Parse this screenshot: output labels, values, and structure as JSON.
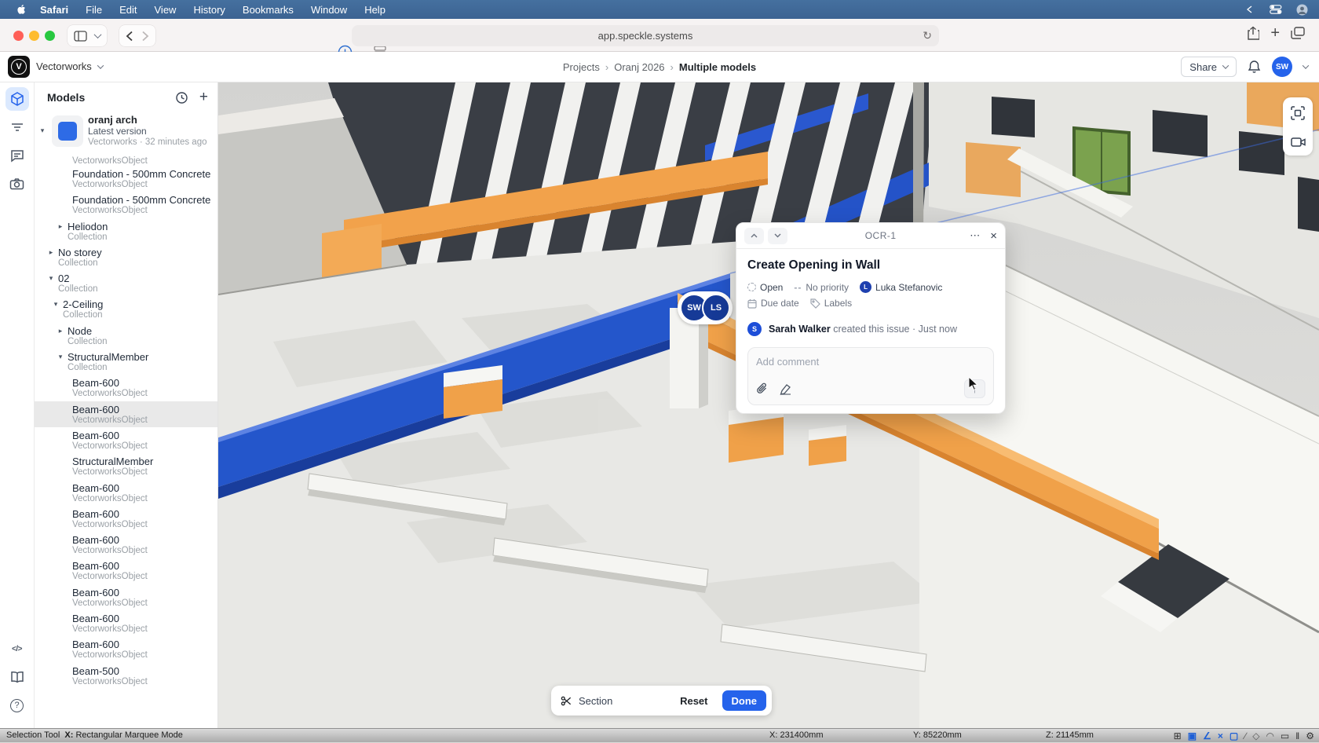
{
  "palette": {
    "accent": "#2563eb",
    "beam_orange": "#f0a149",
    "beam_blue": "#2456cb"
  },
  "menubar": {
    "items": [
      {
        "label": "Safari",
        "cls": "bold"
      },
      {
        "label": "File",
        "cls": ""
      },
      {
        "label": "Edit",
        "cls": ""
      },
      {
        "label": "View",
        "cls": ""
      },
      {
        "label": "History",
        "cls": ""
      },
      {
        "label": "Bookmarks",
        "cls": ""
      },
      {
        "label": "Window",
        "cls": ""
      },
      {
        "label": "Help",
        "cls": ""
      }
    ]
  },
  "browser": {
    "url": "app.speckle.systems",
    "reload_glyph": "↻",
    "new_tab_glyph": "+"
  },
  "app_header": {
    "workspace": "Vectorworks",
    "breadcrumbs": [
      "Projects",
      "Oranj 2026",
      "Multiple models"
    ],
    "share_label": "Share",
    "avatar_initials": "SW"
  },
  "models_panel": {
    "title": "Models",
    "model": {
      "name": "oranj arch",
      "version": "Latest version",
      "meta": "Vectorworks · 32 minutes ago",
      "caret": "▾"
    },
    "tree": [
      {
        "name": "",
        "type": "VectorworksObject",
        "dc": "d4",
        "arrow": "",
        "state": "clipped"
      },
      {
        "name": "Foundation - 500mm Concrete",
        "type": "VectorworksObject",
        "dc": "d4",
        "arrow": "",
        "state": ""
      },
      {
        "name": "Foundation - 500mm Concrete",
        "type": "VectorworksObject",
        "dc": "d4",
        "arrow": "",
        "state": ""
      },
      {
        "name": "Heliodon",
        "type": "Collection",
        "dc": "d3",
        "arrow": "▸",
        "state": ""
      },
      {
        "name": "No storey",
        "type": "Collection",
        "dc": "d1",
        "arrow": "▸",
        "state": ""
      },
      {
        "name": "02",
        "type": "Collection",
        "dc": "d1",
        "arrow": "▾",
        "state": ""
      },
      {
        "name": "2-Ceiling",
        "type": "Collection",
        "dc": "d2",
        "arrow": "▾",
        "state": ""
      },
      {
        "name": "Node",
        "type": "Collection",
        "dc": "d3",
        "arrow": "▸",
        "state": ""
      },
      {
        "name": "StructuralMember",
        "type": "Collection",
        "dc": "d3",
        "arrow": "▾",
        "state": ""
      },
      {
        "name": "Beam-600",
        "type": "VectorworksObject",
        "dc": "d4",
        "arrow": "",
        "state": ""
      },
      {
        "name": "Beam-600",
        "type": "VectorworksObject",
        "dc": "d4",
        "arrow": "",
        "state": "selected"
      },
      {
        "name": "Beam-600",
        "type": "VectorworksObject",
        "dc": "d4",
        "arrow": "",
        "state": ""
      },
      {
        "name": "StructuralMember",
        "type": "VectorworksObject",
        "dc": "d4",
        "arrow": "",
        "state": ""
      },
      {
        "name": "Beam-600",
        "type": "VectorworksObject",
        "dc": "d4",
        "arrow": "",
        "state": ""
      },
      {
        "name": "Beam-600",
        "type": "VectorworksObject",
        "dc": "d4",
        "arrow": "",
        "state": ""
      },
      {
        "name": "Beam-600",
        "type": "VectorworksObject",
        "dc": "d4",
        "arrow": "",
        "state": ""
      },
      {
        "name": "Beam-600",
        "type": "VectorworksObject",
        "dc": "d4",
        "arrow": "",
        "state": ""
      },
      {
        "name": "Beam-600",
        "type": "VectorworksObject",
        "dc": "d4",
        "arrow": "",
        "state": ""
      },
      {
        "name": "Beam-600",
        "type": "VectorworksObject",
        "dc": "d4",
        "arrow": "",
        "state": ""
      },
      {
        "name": "Beam-600",
        "type": "VectorworksObject",
        "dc": "d4",
        "arrow": "",
        "state": ""
      },
      {
        "name": "Beam-500",
        "type": "VectorworksObject",
        "dc": "d4",
        "arrow": "",
        "state": ""
      }
    ]
  },
  "viewport": {
    "avatars": [
      {
        "initials": "SW"
      },
      {
        "initials": "LS"
      }
    ]
  },
  "dialog": {
    "id": "OCR-1",
    "dots": "⋯",
    "close": "×",
    "title": "Create Opening in Wall",
    "status": "Open",
    "priority": "No priority",
    "assignee": "Luka Stefanovic",
    "assignee_initial": "L",
    "due_date": "Due date",
    "labels": "Labels",
    "activity_user": "Sarah Walker",
    "activity_user_initial": "S",
    "activity_text": "created this issue",
    "activity_sep": "·",
    "activity_time": "Just now",
    "comment_placeholder": "Add comment",
    "send_glyph": "↑"
  },
  "section_bar": {
    "section_label": "Section",
    "reset_label": "Reset",
    "done_label": "Done"
  },
  "statusbar": {
    "tool": "Selection Tool",
    "mode_key": "X:",
    "mode": "Rectangular Marquee Mode",
    "coord_x": "X: 231400mm",
    "coord_y": "Y: 85220mm",
    "coord_z": "Z: 21145mm",
    "icons": [
      {
        "g": "⊞",
        "c": "ic-dark"
      },
      {
        "g": "▣",
        "c": "ic-blue"
      },
      {
        "g": "∠",
        "c": "ic-blue"
      },
      {
        "g": "×",
        "c": "ic-blue"
      },
      {
        "g": "▢",
        "c": "ic-blue"
      },
      {
        "g": "∕",
        "c": "ic-gray"
      },
      {
        "g": "◇",
        "c": "ic-gray"
      },
      {
        "g": "◠",
        "c": "ic-gray"
      },
      {
        "g": "▭",
        "c": "ic-dark"
      },
      {
        "g": "‖",
        "c": "ic-dark"
      },
      {
        "g": "⚙",
        "c": "ic-dark"
      }
    ]
  }
}
